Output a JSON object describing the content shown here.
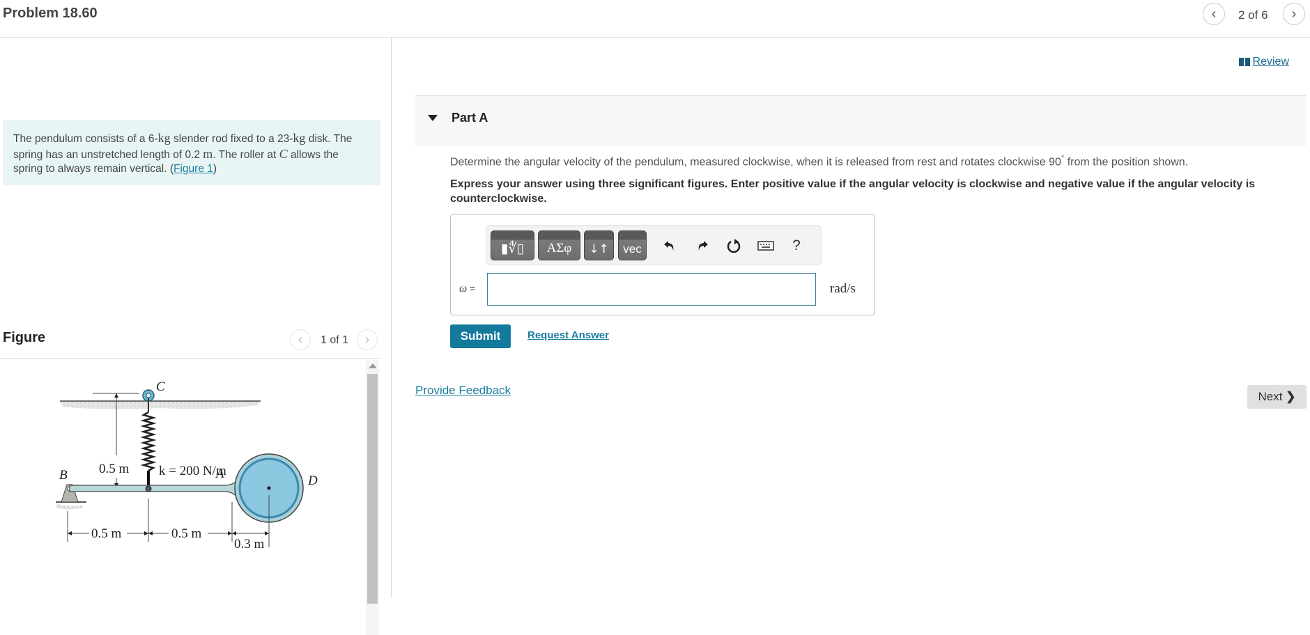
{
  "header": {
    "title": "Problem 18.60",
    "pager": {
      "text": "2 of 6",
      "prev_icon": "chevron-left-icon",
      "next_icon": "chevron-right-icon"
    }
  },
  "intro": {
    "t1": "The pendulum consists of a 6-",
    "kg1": "kg",
    "t2": " slender rod fixed to a 23-",
    "kg2": "kg",
    "t3": " disk. The spring has an unstretched length of 0.2 ",
    "m": "m",
    "t4": ". The roller at ",
    "c": "C",
    "t5": " allows the spring to always remain vertical. (",
    "figure_link": "Figure 1",
    "t6": ")"
  },
  "figure": {
    "title": "Figure",
    "pager": "1 of 1",
    "labels": {
      "c": "C",
      "b": "B",
      "a": "A",
      "d": "D",
      "height": "0.5 m",
      "spring_k": "k = 200 N/m",
      "dim1": "0.5 m",
      "dim2": "0.5 m",
      "dim3": "0.3 m"
    }
  },
  "review": {
    "label": "Review",
    "icon": "book-icon"
  },
  "part": {
    "title": "Part A",
    "question_pre": "Determine the angular velocity of the pendulum, measured clockwise, when it is released from rest and rotates clockwise 90",
    "question_deg": "°",
    "question_post": " from the position shown.",
    "instruction": "Express your answer using three significant figures. Enter positive value if the angular velocity is clockwise and negative value if the angular velocity is counterclockwise.",
    "toolbar": {
      "templates": "▮∜▯",
      "greek": "ΑΣφ",
      "arrows": "↓↑",
      "vec": "vec",
      "help": "?"
    },
    "variable": "ω",
    "equals": " =",
    "answer_value": "",
    "units": "rad/s",
    "submit": "Submit",
    "request_answer": "Request Answer"
  },
  "footer": {
    "feedback": "Provide Feedback",
    "next": "Next"
  }
}
